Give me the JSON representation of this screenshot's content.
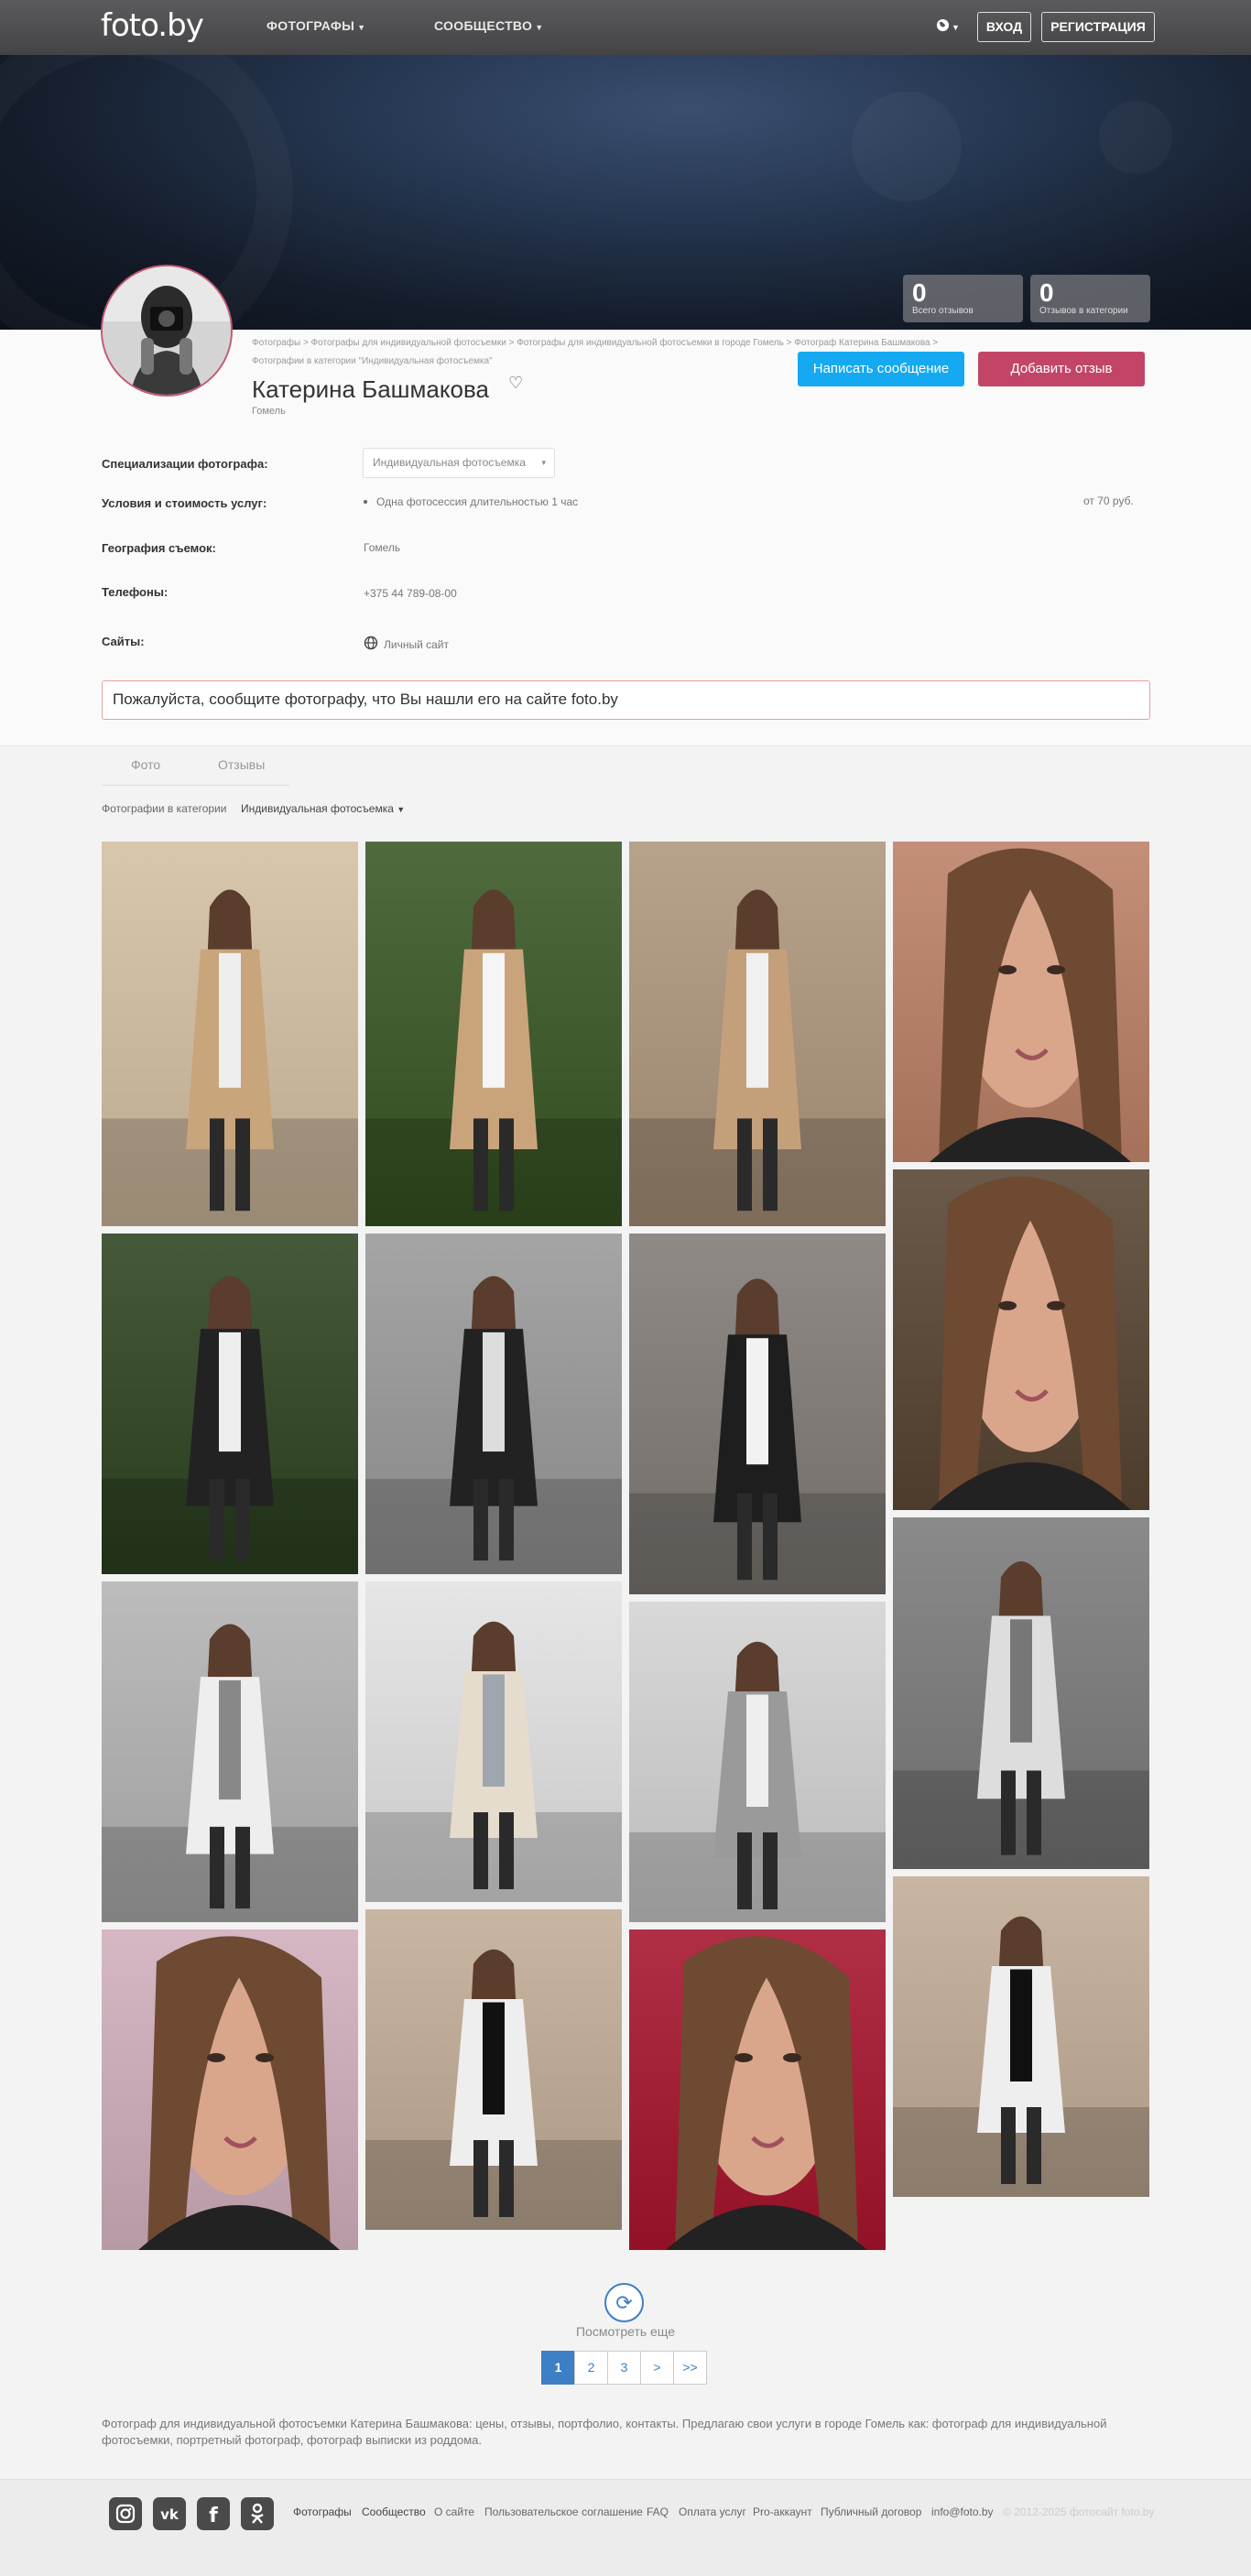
{
  "nav": {
    "logo": "foto.by",
    "items": [
      {
        "label": "ФОТОГРАФЫ"
      },
      {
        "label": "СООБЩЕСТВО"
      }
    ],
    "login": "ВХОД",
    "register": "РЕГИСТРАЦИЯ"
  },
  "stats": [
    {
      "num": "0",
      "label": "Всего отзывов"
    },
    {
      "num": "0",
      "label": "Отзывов в категории"
    }
  ],
  "breadcrumbs": {
    "line1": "Фотографы > Фотографы для индивидуальной фотосъемки > Фотографы для индивидуальной фотосъемки в городе Гомель > Фотограф Катерина Башмакова >",
    "line2": "Фотографии в категории \"Индивидуальная фотосъемка\""
  },
  "profile": {
    "name": "Катерина Башмакова",
    "city": "Гомель",
    "write_message": "Написать сообщение",
    "add_review": "Добавить отзыв"
  },
  "info": {
    "spec_label": "Специализации фотографа:",
    "spec_value": "Индивидуальная фотосъемка",
    "services_label": "Условия и стоимость услуг:",
    "service_item": "Одна фотосессия длительностью 1 час",
    "service_price": "от 70 руб.",
    "geo_label": "География съемок:",
    "geo_value": "Гомель",
    "phone_label": "Телефоны:",
    "phone_value": "+375 44 789-08-00",
    "sites_label": "Сайты:",
    "site_value": "Личный сайт"
  },
  "notice": "Пожалуйста, сообщите фотографу, что Вы нашли его на сайте foto.by",
  "tabs": {
    "photo": "Фото",
    "reviews": "Отзывы"
  },
  "filter": {
    "label": "Фотографии в категории",
    "value": "Индивидуальная фотосъемка"
  },
  "gallery": {
    "colors": {
      "warm": "#d9c7ad",
      "green": "#4f6b3e",
      "street": "#b7a28c",
      "skin": "#c48f78",
      "park": "#465a3b",
      "gray": "#a5a5a5",
      "bridge": "#8f8a86",
      "dark": "#2a2a2a",
      "bw": "#bcbcbc",
      "bwlight": "#e6e6e6",
      "pink": "#d6b7c4",
      "red": "#b12f45",
      "sunset": "#c9b6a2"
    }
  },
  "pagination": {
    "more": "Посмотреть еще",
    "pages": [
      "1",
      "2",
      "3",
      ">",
      ">>"
    ]
  },
  "seo_text": "Фотограф для индивидуальной фотосъемки Катерина Башмакова: цены, отзывы, портфолио, контакты. Предлагаю свои услуги в городе Гомель как: фотограф для индивидуальной фотосъемки, портретный фотограф, фотограф выписки из роддома.",
  "footer": {
    "links": [
      "Фотографы",
      "Сообщество",
      "О сайте",
      "Пользовательское соглашение",
      "FAQ",
      "Оплата услуг",
      "Pro-аккаунт",
      "Публичный договор",
      "info@foto.by"
    ],
    "copyright": "© 2012-2025 фотосайт foto.by"
  }
}
